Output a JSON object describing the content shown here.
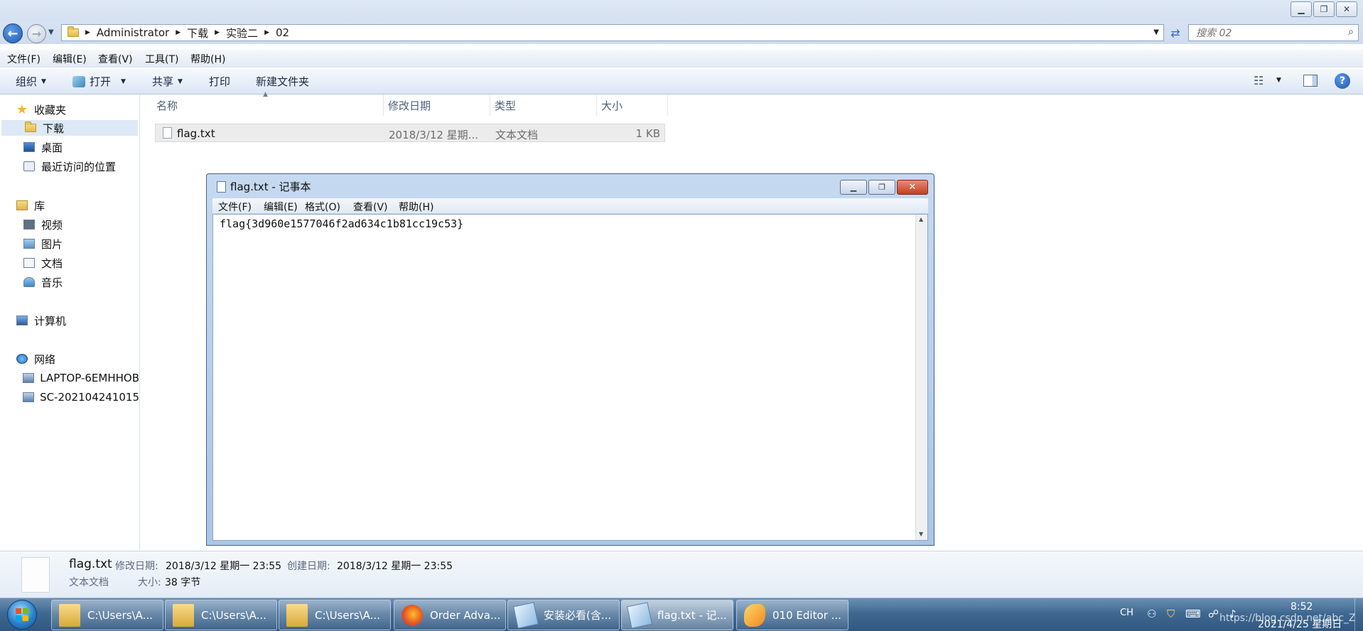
{
  "explorer": {
    "address": {
      "crumbs": [
        "Administrator",
        "下载",
        "实验二",
        "02"
      ]
    },
    "search": {
      "placeholder": "搜索 02"
    },
    "menu": [
      "文件(F)",
      "编辑(E)",
      "查看(V)",
      "工具(T)",
      "帮助(H)"
    ],
    "commands": {
      "organize": "组织",
      "open": "打开",
      "share": "共享",
      "print": "打印",
      "new_folder": "新建文件夹"
    },
    "nav": {
      "favorites": "收藏夹",
      "downloads": "下载",
      "desktop": "桌面",
      "recent": "最近访问的位置",
      "libraries": "库",
      "videos": "视频",
      "pictures": "图片",
      "documents": "文档",
      "music": "音乐",
      "computer": "计算机",
      "network": "网络",
      "host1": "LAPTOP-6EMHHOB",
      "host2": "SC-202104241015"
    },
    "columns": {
      "name": "名称",
      "modified": "修改日期",
      "type": "类型",
      "size": "大小"
    },
    "files": [
      {
        "name": "flag.txt",
        "modified": "2018/3/12 星期...",
        "type": "文本文档",
        "size": "1 KB"
      }
    ],
    "details": {
      "name": "flag.txt",
      "type": "文本文档",
      "modified_label": "修改日期:",
      "modified": "2018/3/12 星期一 23:55",
      "created_label": "创建日期:",
      "created": "2018/3/12 星期一 23:55",
      "size_label": "大小:",
      "size": "38 字节"
    }
  },
  "notepad": {
    "title": "flag.txt - 记事本",
    "menu": [
      "文件(F)",
      "编辑(E)",
      "格式(O)",
      "查看(V)",
      "帮助(H)"
    ],
    "content": "flag{3d960e1577046f2ad634c1b81cc19c53}"
  },
  "taskbar": {
    "items": [
      {
        "label": "C:\\Users\\A...",
        "icon": "folder-icon"
      },
      {
        "label": "C:\\Users\\A...",
        "icon": "folder-icon"
      },
      {
        "label": "C:\\Users\\A...",
        "icon": "folder-icon"
      },
      {
        "label": "Order Adva...",
        "icon": "firefox-icon"
      },
      {
        "label": "安装必看(含...",
        "icon": "notepad-icon"
      },
      {
        "label": "flag.txt - 记...",
        "icon": "notepad-icon"
      },
      {
        "label": "010 Editor ...",
        "icon": "010-editor-icon"
      }
    ],
    "tray": {
      "lang": "CH",
      "time": "8:52",
      "date": "2021/4/25 星期日",
      "watermark": "https://blog.csdn.net/abc_Z"
    }
  }
}
